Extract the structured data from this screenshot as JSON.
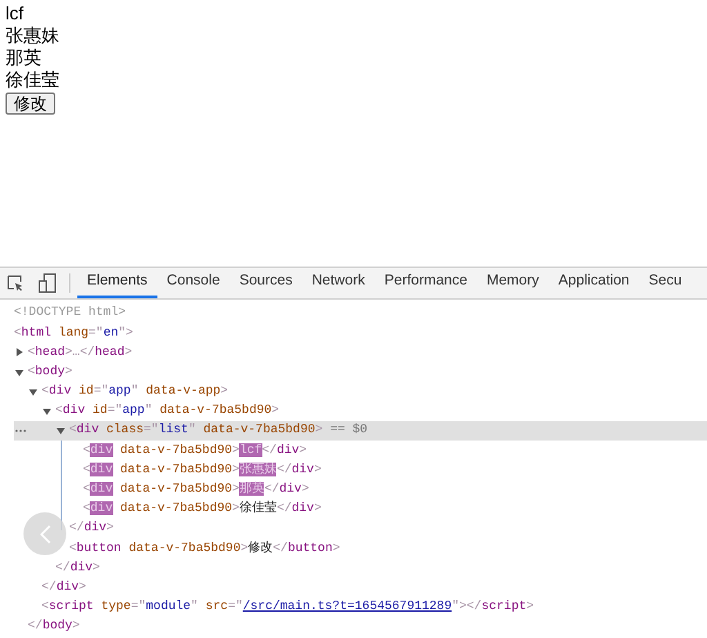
{
  "page": {
    "items": [
      "lcf",
      "张惠妹",
      "那英",
      "徐佳莹"
    ],
    "button": "修改"
  },
  "devtools": {
    "tabs": [
      {
        "label": "Elements",
        "selected": true
      },
      {
        "label": "Console",
        "selected": false
      },
      {
        "label": "Sources",
        "selected": false
      },
      {
        "label": "Network",
        "selected": false
      },
      {
        "label": "Performance",
        "selected": false
      },
      {
        "label": "Memory",
        "selected": false
      },
      {
        "label": "Application",
        "selected": false
      },
      {
        "label": "Secu",
        "selected": false
      }
    ],
    "tree": [
      {
        "selected": false,
        "segments": [
          {
            "kind": "comment",
            "text": "<!DOCTYPE html>"
          }
        ]
      },
      {
        "selected": false,
        "segments": [
          {
            "kind": "punct",
            "text": "<"
          },
          {
            "kind": "tag",
            "text": "html"
          },
          {
            "kind": "attr",
            "text": " lang"
          },
          {
            "kind": "punct",
            "text": "=\""
          },
          {
            "kind": "value",
            "text": "en"
          },
          {
            "kind": "punct",
            "text": "\">"
          }
        ],
        "children": [
          {
            "selected": false,
            "expanded": false,
            "segments": [
              {
                "kind": "punct",
                "text": "<"
              },
              {
                "kind": "tag",
                "text": "head"
              },
              {
                "kind": "punct",
                "text": ">…</"
              },
              {
                "kind": "tag",
                "text": "head"
              },
              {
                "kind": "punct",
                "text": ">"
              }
            ]
          },
          {
            "selected": false,
            "expanded": true,
            "segments": [
              {
                "kind": "punct",
                "text": "<"
              },
              {
                "kind": "tag",
                "text": "body"
              },
              {
                "kind": "punct",
                "text": ">"
              }
            ],
            "closing": [
              {
                "kind": "punct",
                "text": "</"
              },
              {
                "kind": "tag",
                "text": "body"
              },
              {
                "kind": "punct",
                "text": ">"
              }
            ],
            "children": [
              {
                "selected": false,
                "expanded": true,
                "segments": [
                  {
                    "kind": "punct",
                    "text": "<"
                  },
                  {
                    "kind": "tag",
                    "text": "div"
                  },
                  {
                    "kind": "attr",
                    "text": " id"
                  },
                  {
                    "kind": "punct",
                    "text": "=\""
                  },
                  {
                    "kind": "value",
                    "text": "app"
                  },
                  {
                    "kind": "punct",
                    "text": "\""
                  },
                  {
                    "kind": "attr",
                    "text": " data-v-app"
                  },
                  {
                    "kind": "punct",
                    "text": ">"
                  }
                ],
                "closing": [
                  {
                    "kind": "punct",
                    "text": "</"
                  },
                  {
                    "kind": "tag",
                    "text": "div"
                  },
                  {
                    "kind": "punct",
                    "text": ">"
                  }
                ],
                "children": [
                  {
                    "selected": false,
                    "expanded": true,
                    "segments": [
                      {
                        "kind": "punct",
                        "text": "<"
                      },
                      {
                        "kind": "tag",
                        "text": "div"
                      },
                      {
                        "kind": "attr",
                        "text": " id"
                      },
                      {
                        "kind": "punct",
                        "text": "=\""
                      },
                      {
                        "kind": "value",
                        "text": "app"
                      },
                      {
                        "kind": "punct",
                        "text": "\""
                      },
                      {
                        "kind": "attr",
                        "text": " data-v-7ba5bd90"
                      },
                      {
                        "kind": "punct",
                        "text": ">"
                      }
                    ],
                    "closing": [
                      {
                        "kind": "punct",
                        "text": "</"
                      },
                      {
                        "kind": "tag",
                        "text": "div"
                      },
                      {
                        "kind": "punct",
                        "text": ">"
                      }
                    ],
                    "children": [
                      {
                        "selected": true,
                        "expanded": true,
                        "segments": [
                          {
                            "kind": "punct",
                            "text": "<"
                          },
                          {
                            "kind": "tag",
                            "text": "div"
                          },
                          {
                            "kind": "attr",
                            "text": " class"
                          },
                          {
                            "kind": "punct",
                            "text": "=\""
                          },
                          {
                            "kind": "value",
                            "text": "list"
                          },
                          {
                            "kind": "punct",
                            "text": "\""
                          },
                          {
                            "kind": "attr",
                            "text": " data-v-7ba5bd90"
                          },
                          {
                            "kind": "punct",
                            "text": ">"
                          },
                          {
                            "kind": "note",
                            "text": " == $0"
                          }
                        ],
                        "closing": [
                          {
                            "kind": "punct",
                            "text": "</"
                          },
                          {
                            "kind": "tag",
                            "text": "div"
                          },
                          {
                            "kind": "punct",
                            "text": ">"
                          }
                        ],
                        "children": [
                          {
                            "selected": false,
                            "segments": [
                              {
                                "kind": "punct",
                                "text": "<"
                              },
                              {
                                "kind": "match",
                                "text": "div"
                              },
                              {
                                "kind": "attr",
                                "text": " data-v-7ba5bd90"
                              },
                              {
                                "kind": "punct",
                                "text": ">"
                              },
                              {
                                "kind": "match",
                                "text": "lcf"
                              },
                              {
                                "kind": "punct",
                                "text": "</"
                              },
                              {
                                "kind": "tag",
                                "text": "div"
                              },
                              {
                                "kind": "punct",
                                "text": ">"
                              }
                            ]
                          },
                          {
                            "selected": false,
                            "segments": [
                              {
                                "kind": "punct",
                                "text": "<"
                              },
                              {
                                "kind": "match",
                                "text": "div"
                              },
                              {
                                "kind": "attr",
                                "text": " data-v-7ba5bd90"
                              },
                              {
                                "kind": "punct",
                                "text": ">"
                              },
                              {
                                "kind": "match",
                                "text": "张惠妹"
                              },
                              {
                                "kind": "punct",
                                "text": "</"
                              },
                              {
                                "kind": "tag",
                                "text": "div"
                              },
                              {
                                "kind": "punct",
                                "text": ">"
                              }
                            ]
                          },
                          {
                            "selected": false,
                            "segments": [
                              {
                                "kind": "punct",
                                "text": "<"
                              },
                              {
                                "kind": "match",
                                "text": "div"
                              },
                              {
                                "kind": "attr",
                                "text": " data-v-7ba5bd90"
                              },
                              {
                                "kind": "punct",
                                "text": ">"
                              },
                              {
                                "kind": "match",
                                "text": "那英"
                              },
                              {
                                "kind": "punct",
                                "text": "</"
                              },
                              {
                                "kind": "tag",
                                "text": "div"
                              },
                              {
                                "kind": "punct",
                                "text": ">"
                              }
                            ]
                          },
                          {
                            "selected": false,
                            "segments": [
                              {
                                "kind": "punct",
                                "text": "<"
                              },
                              {
                                "kind": "match",
                                "text": "div"
                              },
                              {
                                "kind": "attr",
                                "text": " data-v-7ba5bd90"
                              },
                              {
                                "kind": "punct",
                                "text": ">"
                              },
                              {
                                "kind": "text",
                                "text": "徐佳莹"
                              },
                              {
                                "kind": "punct",
                                "text": "</"
                              },
                              {
                                "kind": "tag",
                                "text": "div"
                              },
                              {
                                "kind": "punct",
                                "text": ">"
                              }
                            ]
                          }
                        ]
                      },
                      {
                        "selected": false,
                        "segments": [
                          {
                            "kind": "punct",
                            "text": "<"
                          },
                          {
                            "kind": "tag",
                            "text": "button"
                          },
                          {
                            "kind": "attr",
                            "text": " data-v-7ba5bd90"
                          },
                          {
                            "kind": "punct",
                            "text": ">"
                          },
                          {
                            "kind": "text",
                            "text": "修改"
                          },
                          {
                            "kind": "punct",
                            "text": "</"
                          },
                          {
                            "kind": "tag",
                            "text": "button"
                          },
                          {
                            "kind": "punct",
                            "text": ">"
                          }
                        ]
                      }
                    ]
                  }
                ]
              },
              {
                "selected": false,
                "segments": [
                  {
                    "kind": "punct",
                    "text": "<"
                  },
                  {
                    "kind": "tag",
                    "text": "script"
                  },
                  {
                    "kind": "attr",
                    "text": " type"
                  },
                  {
                    "kind": "punct",
                    "text": "=\""
                  },
                  {
                    "kind": "value",
                    "text": "module"
                  },
                  {
                    "kind": "punct",
                    "text": "\""
                  },
                  {
                    "kind": "attr",
                    "text": " src"
                  },
                  {
                    "kind": "punct",
                    "text": "=\""
                  },
                  {
                    "kind": "link",
                    "text": "/src/main.ts?t=1654567911289"
                  },
                  {
                    "kind": "punct",
                    "text": "\"></"
                  },
                  {
                    "kind": "tag",
                    "text": "script"
                  },
                  {
                    "kind": "punct",
                    "text": ">"
                  }
                ]
              }
            ]
          }
        ]
      }
    ]
  }
}
